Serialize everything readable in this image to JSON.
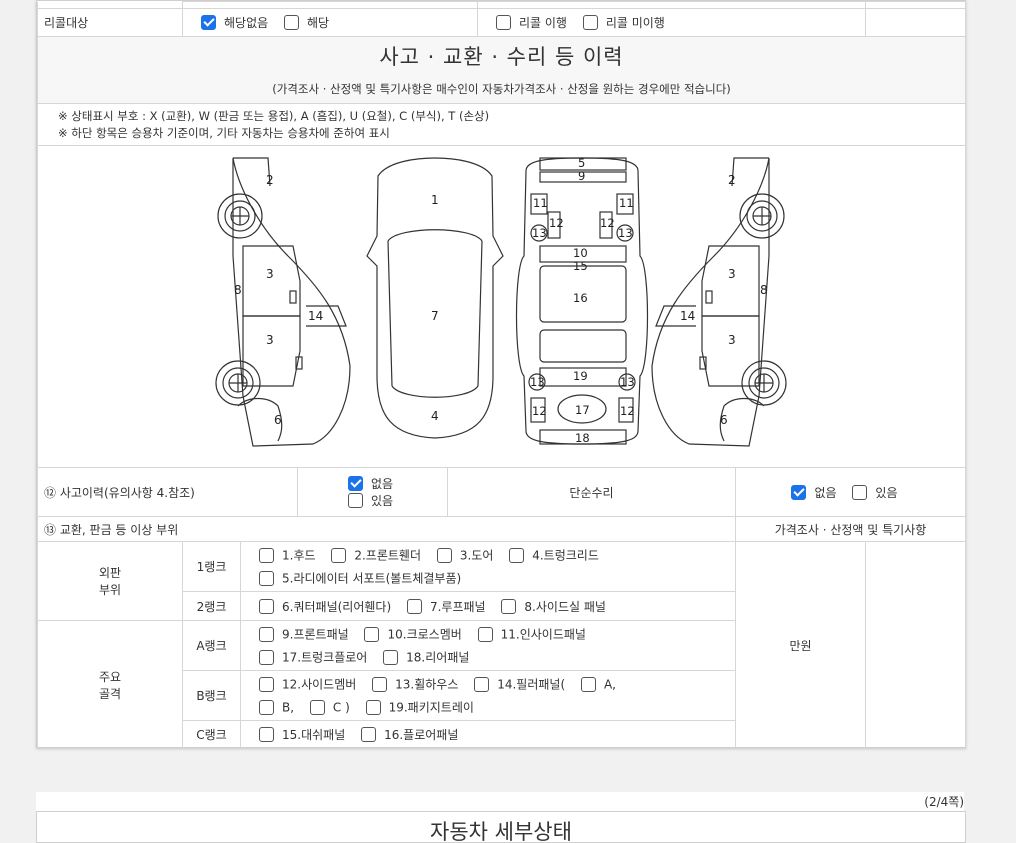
{
  "recall": {
    "label": "리콜대상",
    "options_left": [
      {
        "label": "해당없음",
        "checked": true
      },
      {
        "label": "해당",
        "checked": false
      }
    ],
    "options_right": [
      {
        "label": "리콜 이행",
        "checked": false
      },
      {
        "label": "리콜 미이행",
        "checked": false
      }
    ]
  },
  "history": {
    "title": "사고 · 교환 · 수리 등 이력",
    "subtitle": "(가격조사 · 산정액 및 특기사항은 매수인이 자동차가격조사 · 산정을 원하는 경우에만 적습니다)",
    "note1": "※ 상태표시 부호 : X (교환), W (판금 또는 용접), A (흠집), U (요철), C (부식), T (손상)",
    "note2": "※ 하단 항목은 승용차 기준이며, 기타 자동차는 승용차에 준하여 표시"
  },
  "diagram": {
    "left_side": [
      "2",
      "3",
      "8",
      "14",
      "3",
      "6"
    ],
    "top_view": [
      "1",
      "7",
      "4"
    ],
    "frame_view": [
      "5",
      "9",
      "11",
      "12",
      "12",
      "11",
      "13",
      "13",
      "10",
      "15",
      "16",
      "19",
      "13",
      "13",
      "17",
      "12",
      "12",
      "18"
    ],
    "right_side": [
      "2",
      "3",
      "8",
      "14",
      "3",
      "6"
    ]
  },
  "accident": {
    "label": "⑫ 사고이력(유의사항 4.참조)",
    "options": [
      {
        "label": "없음",
        "checked": true
      },
      {
        "label": "있음",
        "checked": false
      }
    ],
    "simple_repair_label": "단순수리",
    "simple_repair_options": [
      {
        "label": "없음",
        "checked": true
      },
      {
        "label": "있음",
        "checked": false
      }
    ]
  },
  "parts": {
    "label": "⑬ 교환, 판금 등 이상 부위",
    "price_header": "가격조사 · 산정액 및 특기사항",
    "price_unit": "만원",
    "outer_label_1": "외판",
    "outer_label_2": "부위",
    "main_label_1": "주요",
    "main_label_2": "골격",
    "rank1_label": "1랭크",
    "rank1_line1": [
      "1.후드",
      "2.프론트휀더",
      "3.도어",
      "4.트렁크리드"
    ],
    "rank1_line2": [
      "5.라디에이터 서포트(볼트체결부품)"
    ],
    "rank2_label": "2랭크",
    "rank2_line1": [
      "6.쿼터패널(리어휀다)",
      "7.루프패널",
      "8.사이드실 패널"
    ],
    "rankA_label": "A랭크",
    "rankA_line1": [
      "9.프론트패널",
      "10.크로스멤버",
      "11.인사이드패널"
    ],
    "rankA_line2": [
      "17.트렁크플로어",
      "18.리어패널"
    ],
    "rankB_label": "B랭크",
    "rankB_line1": [
      "12.사이드멤버",
      "13.휠하우스",
      "14.필러패널(",
      "A,"
    ],
    "rankB_line2": [
      "B,",
      "C )",
      "19.패키지트레이"
    ],
    "rankC_label": "C랭크",
    "rankC_line1": [
      "15.대쉬패널",
      "16.플로어패널"
    ]
  },
  "footer": {
    "page_number": "(2/4쪽)",
    "next_title": "자동차 세부상태"
  }
}
